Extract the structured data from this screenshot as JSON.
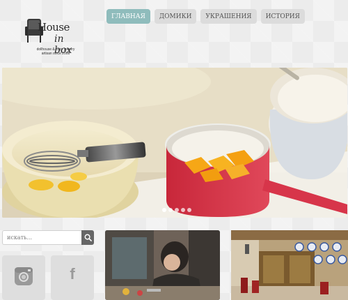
{
  "logo": {
    "word1": "House",
    "word2": "in box",
    "tagline_line1": "dollhouse & cozy jewelry",
    "tagline_line2": "artisan since 2008"
  },
  "nav": {
    "items": [
      {
        "label": "ГЛАВНАЯ",
        "active": true
      },
      {
        "label": "ДОМИКИ",
        "active": false
      },
      {
        "label": "УКРАШЕНИЯ",
        "active": false
      },
      {
        "label": "ИСТОРИЯ",
        "active": false
      }
    ]
  },
  "hero": {
    "slide_count": 5,
    "active_index": 0
  },
  "search": {
    "placeholder": "искать..."
  },
  "social": {
    "instagram_icon": "instagram-icon",
    "facebook_glyph": "f"
  },
  "colors": {
    "nav_active": "#8fbcbc",
    "nav_inactive": "#dcdcdc",
    "search_button": "#666666"
  }
}
